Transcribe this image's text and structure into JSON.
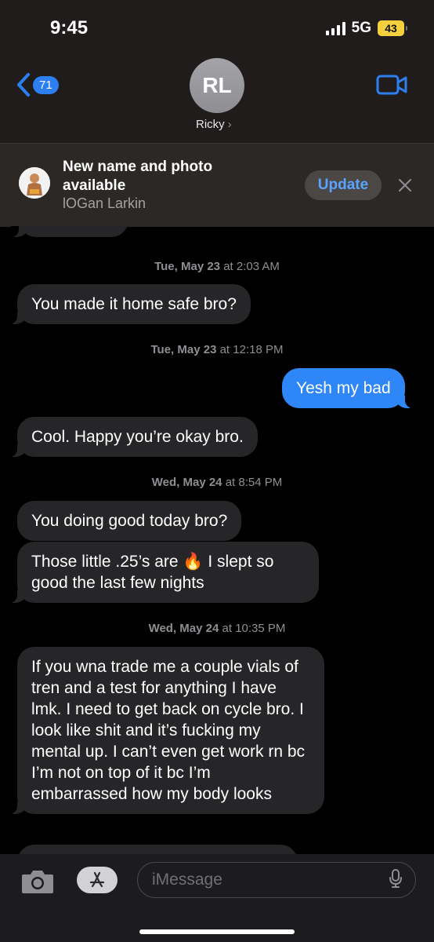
{
  "status_bar": {
    "time": "9:45",
    "network": "5G",
    "battery": "43"
  },
  "header": {
    "back_count": "71",
    "avatar_initials": "RL",
    "contact_name": "Ricky"
  },
  "banner": {
    "title": "New name and photo available",
    "subtitle": "lOGan Larkin",
    "update_label": "Update"
  },
  "messages": [
    {
      "type": "timestamp",
      "day": "Tue, May 23",
      "time": "at 2:03 AM"
    },
    {
      "type": "incoming",
      "text": "You made it home safe bro?"
    },
    {
      "type": "timestamp",
      "day": "Tue, May 23",
      "time": "at 12:18 PM"
    },
    {
      "type": "outgoing",
      "text": "Yesh my bad"
    },
    {
      "type": "incoming",
      "text": "Cool. Happy you’re okay bro."
    },
    {
      "type": "timestamp",
      "day": "Wed, May 24",
      "time": "at 8:54 PM"
    },
    {
      "type": "incoming",
      "text": "You doing good today bro?"
    },
    {
      "type": "incoming",
      "text_a": "Those little .25’s are",
      "emoji": "🔥",
      "text_b": "I slept so good the last few nights"
    },
    {
      "type": "timestamp",
      "day": "Wed, May 24",
      "time": "at 10:35 PM"
    },
    {
      "type": "incoming",
      "text": "If you wna trade me a couple vials of tren and a test for anything I have lmk. I need to get back on cycle bro. I look like shit and it’s fucking my mental up. I can’t even get work rn bc I’m not on top of it bc I’m embarrassed how my body looks"
    }
  ],
  "composer": {
    "placeholder": "iMessage"
  },
  "colors": {
    "accent": "#2f86f6",
    "incoming_bubble": "#262629",
    "header_bg": "#1f1c1b"
  }
}
